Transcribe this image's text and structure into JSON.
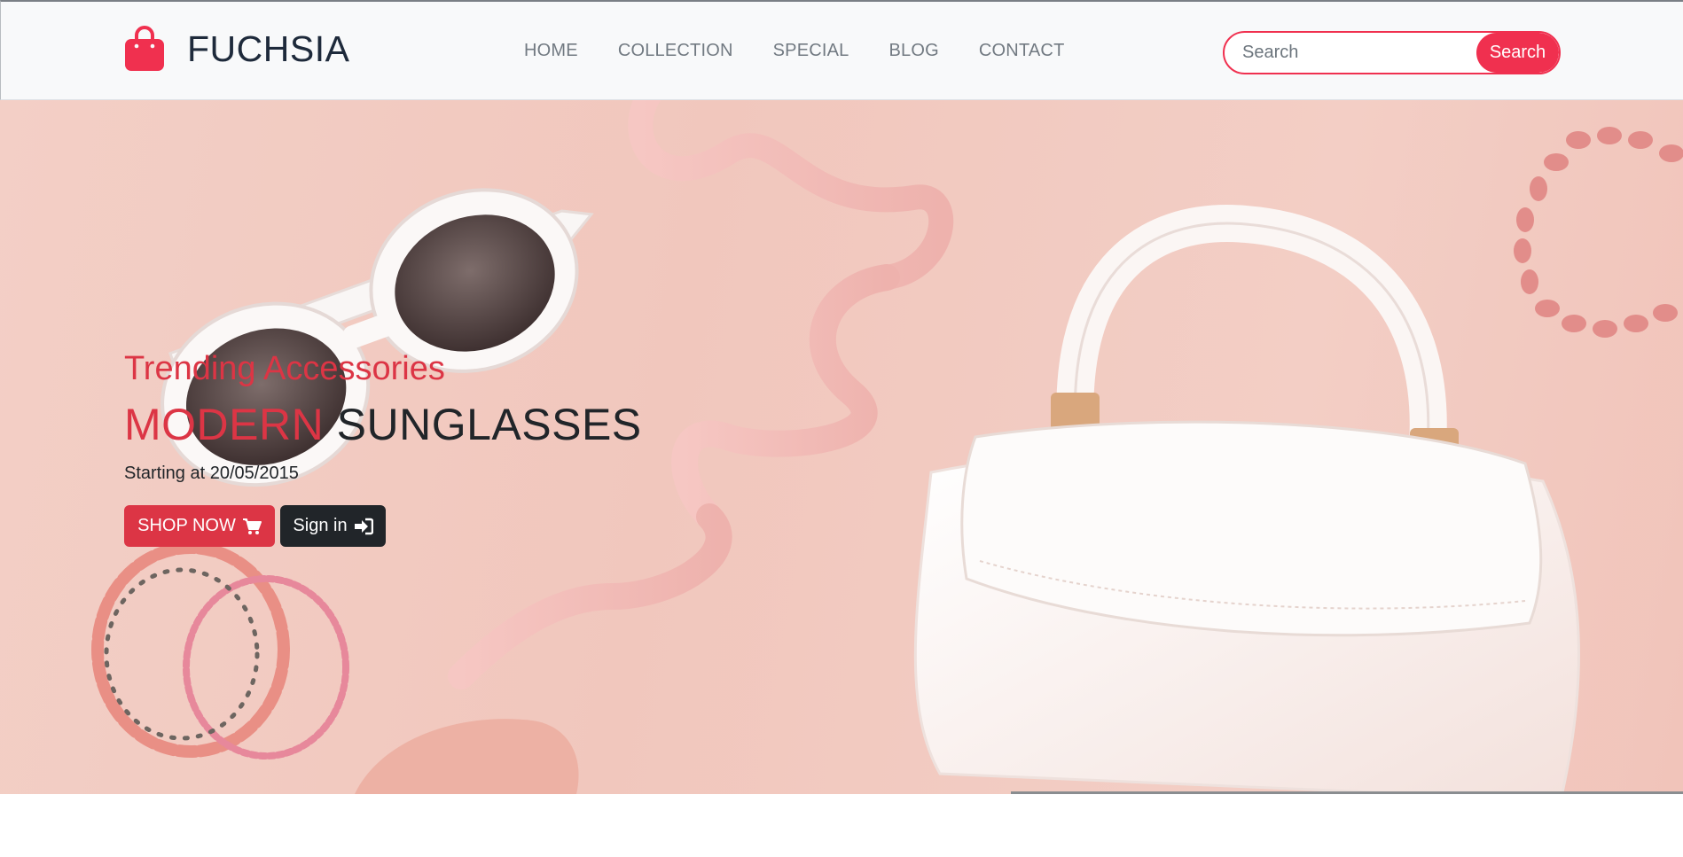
{
  "brand": {
    "name": "FUCHSIA",
    "icon": "shopping-bag-icon",
    "color": "#f0304f"
  },
  "nav": {
    "items": [
      "HOME",
      "COLLECTION",
      "SPECIAL",
      "BLOG",
      "CONTACT"
    ]
  },
  "search": {
    "placeholder": "Search",
    "button_label": "Search"
  },
  "hero": {
    "subtitle": "Trending Accessories",
    "title_highlight": "MODERN",
    "title_rest": "SUNGLASSES",
    "date_text": "Starting at 20/05/2015",
    "shop_button": {
      "label": "SHOP NOW",
      "icon": "shopping-cart-icon"
    },
    "signin_button": {
      "label": "Sign in",
      "icon": "sign-in-icon"
    }
  },
  "colors": {
    "accent": "#dc3545",
    "brand": "#f0304f",
    "dark": "#212529"
  }
}
